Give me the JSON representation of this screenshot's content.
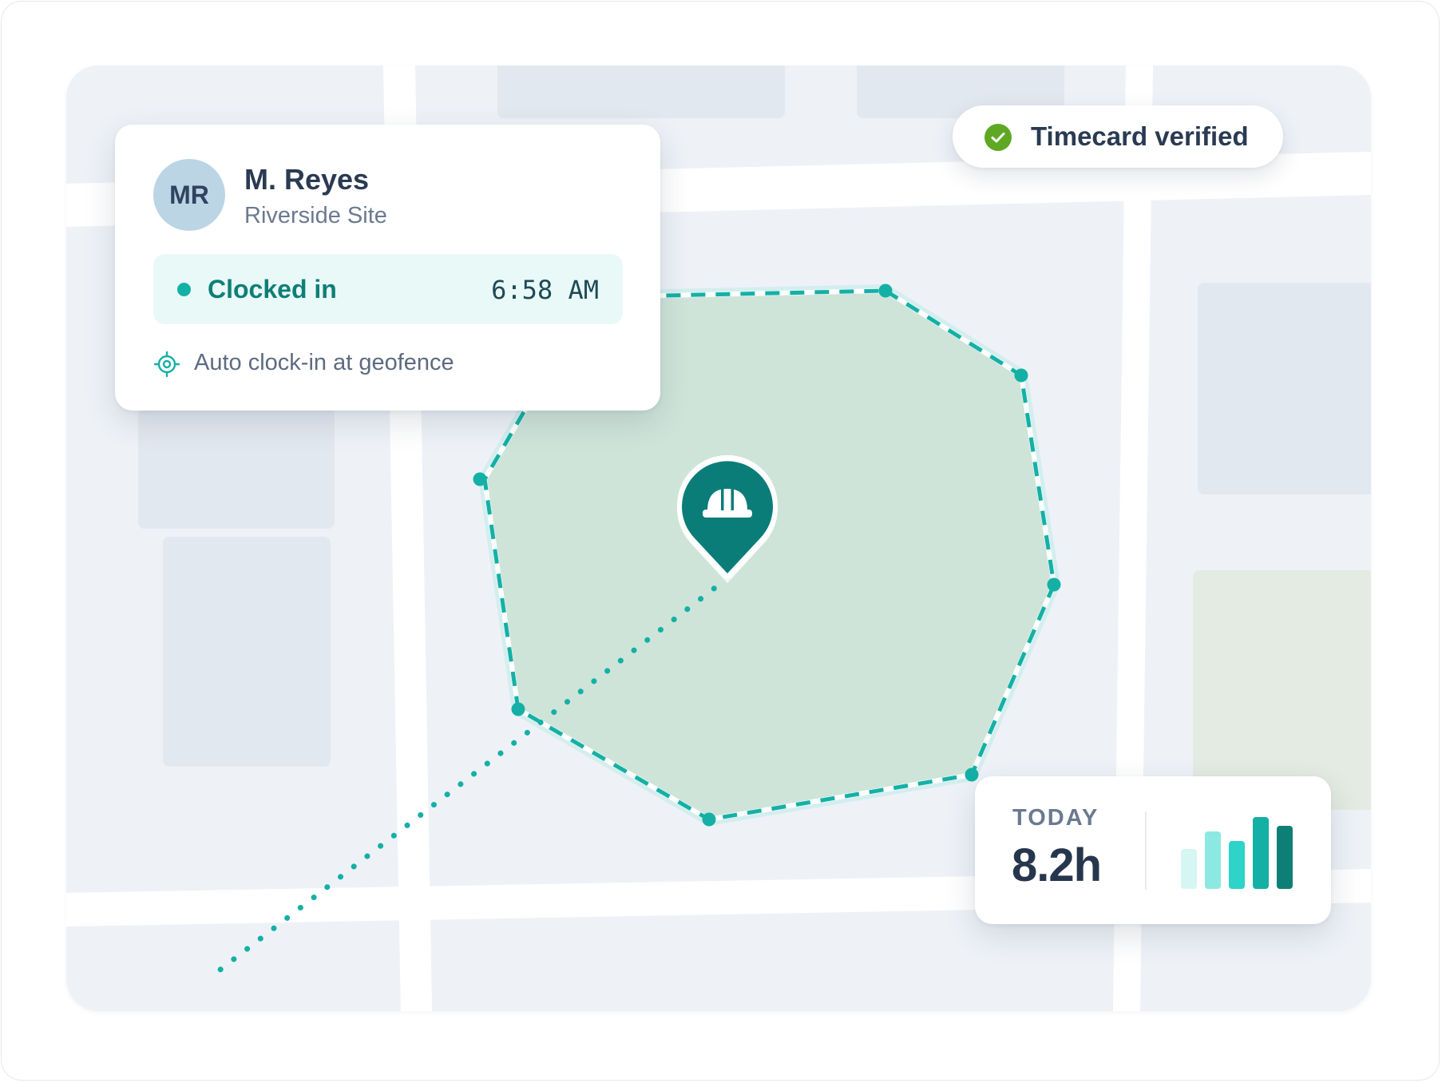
{
  "worker": {
    "initials": "MR",
    "name": "M. Reyes",
    "site": "Riverside Site",
    "status_label": "Clocked in",
    "clock_time": "6:58 AM",
    "auto_note": "Auto clock-in at geofence"
  },
  "verification": {
    "label": "Timecard verified"
  },
  "today": {
    "label": "TODAY",
    "hours": "8.2h",
    "bar_levels": [
      0.55,
      0.8,
      0.67,
      1.0,
      0.88
    ]
  },
  "map": {
    "pin_icon": "hard-hat-icon"
  },
  "colors": {
    "accent": "#14b0a6",
    "accent_dark": "#0a7d78",
    "geofence_fill": "#cfe4d9",
    "check_green": "#5fa823",
    "bars": [
      "#d6f6f3",
      "#8ce9e2",
      "#2dd4c7",
      "#14b0a6",
      "#0e7f77"
    ]
  }
}
